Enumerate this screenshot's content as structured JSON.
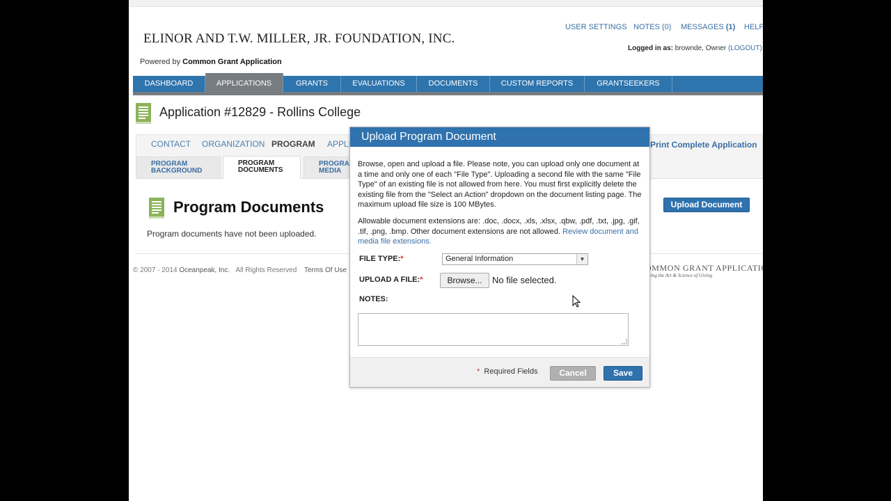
{
  "header": {
    "org_name": "ELINOR AND T.W. MILLER, JR. FOUNDATION, INC.",
    "powered_prefix": "Powered by ",
    "powered_name": "Common Grant Application"
  },
  "toplinks": {
    "user_settings": "USER SETTINGS",
    "notes": "NOTES (0)",
    "messages": "MESSAGES",
    "messages_count": "(1)",
    "help": "HELP"
  },
  "login": {
    "prefix": "Logged in as:",
    "user": "browndе",
    "role": "Owner",
    "logout": "(LOGOUT)"
  },
  "nav": {
    "items": [
      "DASHBOARD",
      "APPLICATIONS",
      "GRANTS",
      "EVALUATIONS",
      "DOCUMENTS",
      "CUSTOM REPORTS",
      "GRANTSEEKERS"
    ],
    "active": "APPLICATIONS"
  },
  "application": {
    "title": "Application #12829 - Rollins College"
  },
  "subtabs": [
    "CONTACT",
    "ORGANIZATION",
    "PROGRAM",
    "APPLI"
  ],
  "print_link": "Print Complete Application",
  "pagetabs": [
    {
      "line1": "PROGRAM",
      "line2": "BACKGROUND"
    },
    {
      "line1": "PROGRAM",
      "line2": "DOCUMENTS"
    },
    {
      "line1": "PROGRA",
      "line2": "MEDIA"
    }
  ],
  "program_documents": {
    "title": "Program Documents",
    "empty_text": "Program documents have not been uploaded.",
    "upload_button": "Upload Document"
  },
  "footer": {
    "copyright": "© 2007 - 2014",
    "company": "Oceanpeak, Inc.",
    "rights": "All Rights Reserved",
    "terms": "Terms Of Use",
    "logo_text": "OMMON GRANT APPLICATION",
    "logo_tagline": "lifying the Art & Science of Giving"
  },
  "modal": {
    "title": "Upload Program Document",
    "description": "Browse, open and upload a file. Please note, you can upload only one document at a time and only one of each \"File Type\". Uploading a second file with the same \"File Type\" of an existing file is not allowed from here. You must first explicitly delete the existing file from the \"Select an Action\" dropdown on the document listing page. The maximum upload file size is 100 MBytes.",
    "extensions_text": "Allowable document extensions are: .doc, .docx, .xls, .xlsx, .qbw, .pdf, .txt, .jpg, .gif, .tif, .png, .bmp. Other document extensions are not allowed.",
    "extensions_link": "Review document and media file extensions.",
    "file_type_label": "FILE TYPE:",
    "file_type_value": "General Information",
    "upload_label": "UPLOAD A FILE:",
    "browse_button": "Browse...",
    "no_file": "No file selected.",
    "notes_label": "NOTES:",
    "notes_value": "",
    "required_star": "*",
    "required_note": "Required Fields",
    "cancel_button": "Cancel",
    "save_button": "Save"
  },
  "colors": {
    "nav_blue": "#2e74ad",
    "nav_active_gray": "#777c80",
    "link_blue": "#3a6ea5",
    "required_red": "#cc3333"
  },
  "icons": [
    "document-icon",
    "chevron-down-icon",
    "resize-grip-icon",
    "mouse-cursor-icon"
  ]
}
